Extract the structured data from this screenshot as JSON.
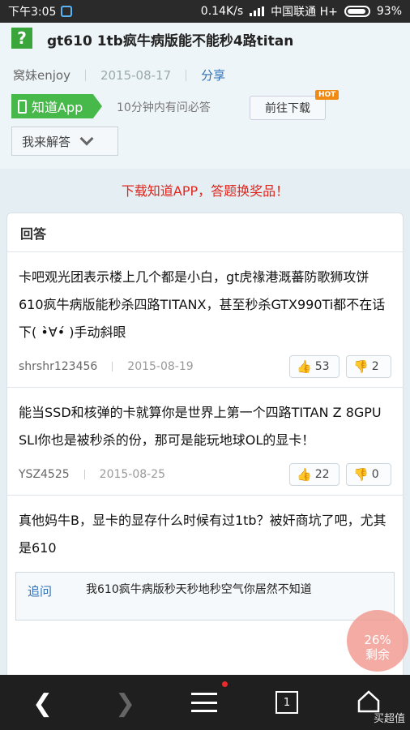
{
  "status_bar": {
    "time": "下午3:05",
    "network_speed": "0.14K/s",
    "carrier": "中国联通 H+",
    "battery": "93%"
  },
  "question": {
    "title": "gt610 1tb疯牛病版能不能秒4路titan",
    "author": "窝妹enjoy",
    "date": "2015-08-17",
    "share_label": "分享"
  },
  "app_promo": {
    "app_button": "知道App",
    "tip": "10分钟内有问必答",
    "download_button": "前往下载",
    "hot_badge": "HOT",
    "answer_toggle": "我来解答"
  },
  "promo_banner": "下载知道APP，答题换奖品！",
  "answers_header": "回答",
  "answers": [
    {
      "text": "卡吧观光团表示楼上几个都是小白，gt虎禒港溉蕃防歌狮攻饼610疯牛病版能秒杀四路TITANX，甚至秒杀GTX990Ti都不在话下( •̀∀•́ )手动斜眼",
      "user": "shrshr123456",
      "date": "2015-08-19",
      "up": "53",
      "down": "2"
    },
    {
      "text": "能当SSD和核弹的卡就算你是世界上第一个四路TITAN Z 8GPU SLI你也是被秒杀的份，那可是能玩地球OL的显卡！",
      "user": "YSZ4525",
      "date": "2015-08-25",
      "up": "22",
      "down": "0"
    },
    {
      "text": "真他妈牛B，显卡的显存什么时候有过1tb？被奸商坑了吧，尤其是610"
    }
  ],
  "followup": {
    "label": "追问",
    "text": "我610疯牛病版秒天秒地秒空气你居然不知道"
  },
  "float_progress": {
    "percent": "26%",
    "label": "剩余"
  },
  "bottom_nav": {
    "tabs_count": "1",
    "watermark": "买超值"
  },
  "colors": {
    "accent_green": "#47b84a",
    "link_blue": "#2f6fb3",
    "promo_red": "#e0251d",
    "hot_orange": "#f08a12"
  }
}
